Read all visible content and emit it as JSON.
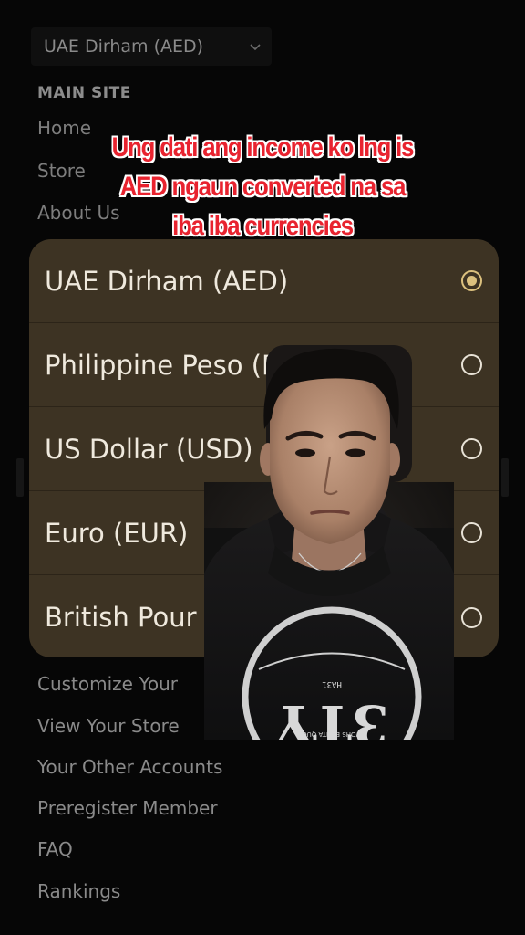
{
  "currency_select": {
    "value": "UAE Dirham (AED)",
    "icon": "chevron-down-icon"
  },
  "main_site": {
    "title": "MAIN SITE",
    "items": [
      "Home",
      "Store",
      "About Us"
    ]
  },
  "caption": {
    "line1": "Ung dati ang income  ko lng is",
    "line2": "AED ngaun converted na sa",
    "line3": "iba iba currencies"
  },
  "currency_options": [
    {
      "label": "UAE Dirham (AED)",
      "selected": true
    },
    {
      "label": "Philippine Peso (P",
      "selected": false
    },
    {
      "label": "US Dollar (USD)",
      "selected": false
    },
    {
      "label": "Euro (EUR)",
      "selected": false
    },
    {
      "label": "British Pour",
      "selected": false
    }
  ],
  "store_links": [
    "Customize Your",
    "View Your Store",
    "Your Other Accounts",
    "Preregister Member",
    "FAQ",
    "Rankings"
  ],
  "shirt_print": {
    "top": "HA31",
    "middle": "3TY",
    "bottom": "SWOHS EDHTA QUOR"
  },
  "colors": {
    "sheet_bg": "#3d3323",
    "selected_radio": "#dcc17e",
    "caption_red": "#e8232f",
    "caption_outline": "#ffffff"
  }
}
